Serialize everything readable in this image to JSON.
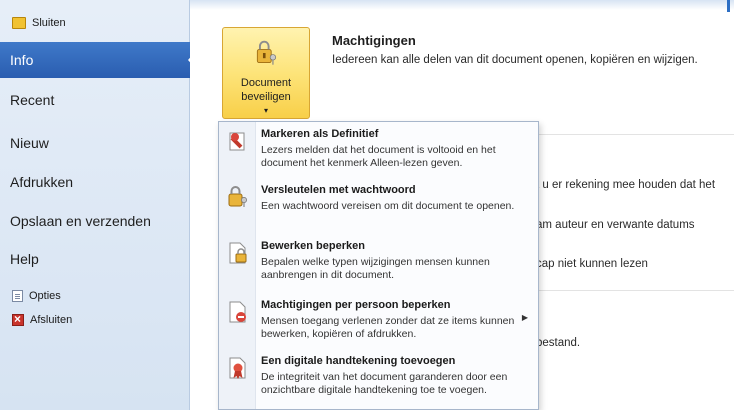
{
  "sidebar": {
    "close": "Sluiten",
    "info": "Info",
    "recent": "Recent",
    "new": "Nieuw",
    "print": "Afdrukken",
    "save_send": "Opslaan en verzenden",
    "help": "Help",
    "options": "Opties",
    "exit": "Afsluiten"
  },
  "protect_button": {
    "line1": "Document",
    "line2": "beveiligen",
    "caret": "▾"
  },
  "permissions": {
    "title": "Machtigingen",
    "description": "Iedereen kan alle delen van dit document openen, kopiëren en wijzigen."
  },
  "background_text": [
    "t u er rekening mee houden dat het",
    "am auteur en verwante datums",
    "cap niet kunnen lezen",
    "bestand."
  ],
  "menu": [
    {
      "title": "Markeren als Definitief",
      "description": "Lezers melden dat het document is voltooid en het document het kenmerk Alleen-lezen geven.",
      "icon": "ribbon-stamp-icon"
    },
    {
      "title": "Versleutelen met wachtwoord",
      "description": "Een wachtwoord vereisen om dit document te openen.",
      "icon": "key-lock-icon"
    },
    {
      "title": "Bewerken beperken",
      "description": "Bepalen welke typen wijzigingen mensen kunnen aanbrengen in dit document.",
      "icon": "document-lock-icon"
    },
    {
      "title": "Machtigingen per persoon beperken",
      "description": "Mensen toegang verlenen zonder dat ze items kunnen bewerken, kopiëren of afdrukken.",
      "icon": "document-restrict-icon",
      "has_submenu": true,
      "arrow": "▶"
    },
    {
      "title": "Een digitale handtekening toevoegen",
      "description": "De integriteit van het document garanderen door een onzichtbare digitale handtekening toe te voegen.",
      "icon": "signature-ribbon-icon"
    }
  ],
  "colors": {
    "active_tab": "#2f67bb",
    "button_gold": "#fde47a",
    "sidebar_bg": "#dfe9f5"
  }
}
